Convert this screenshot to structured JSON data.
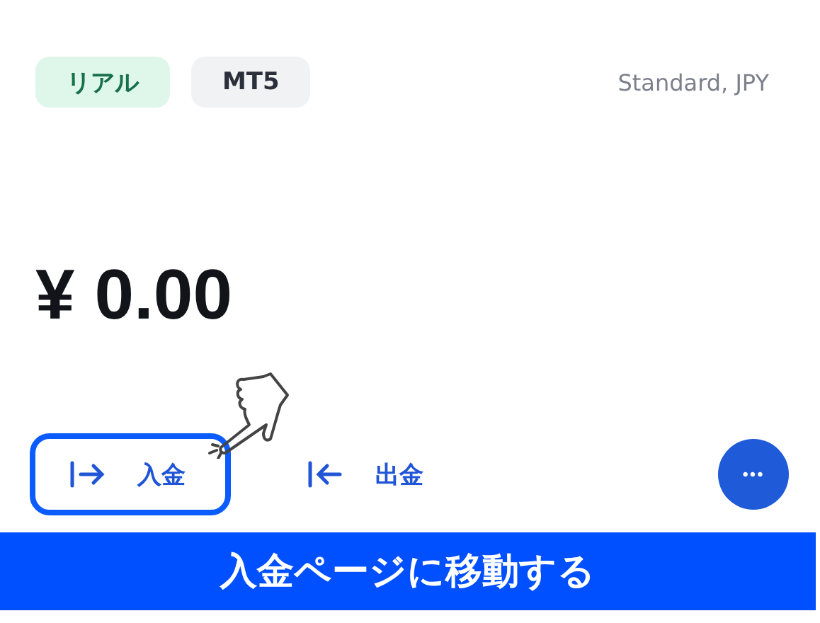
{
  "badges": [
    {
      "label": "リアル",
      "kind": "live"
    },
    {
      "label": "MT5",
      "kind": "platform"
    }
  ],
  "account_type": "Standard, JPY",
  "balance": "¥ 0.00",
  "actions": [
    {
      "label": "入金",
      "kind": "deposit",
      "highlighted": true
    },
    {
      "label": "出金",
      "kind": "withdraw",
      "highlighted": false
    }
  ],
  "more_button": "•••",
  "caption": "入金ページに移動する"
}
